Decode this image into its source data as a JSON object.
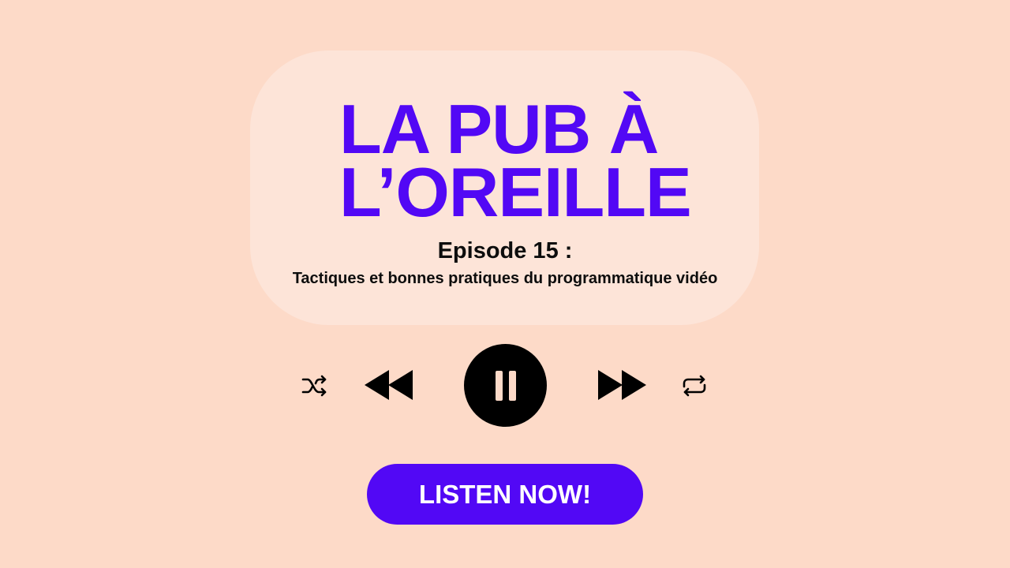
{
  "title": {
    "line1": "LA PUB À",
    "line2": "L’OREILLE"
  },
  "episode": {
    "label": "Episode 15 :",
    "subtitle": "Tactiques et bonnes pratiques du programmatique vidéo"
  },
  "controls": {
    "shuffle_icon": "shuffle-icon",
    "rewind_icon": "rewind-icon",
    "pause_icon": "pause-icon",
    "fast_forward_icon": "fast-forward-icon",
    "repeat_icon": "repeat-icon"
  },
  "cta": {
    "label": "LISTEN NOW!"
  },
  "colors": {
    "background": "#FDDAC8",
    "card": "#FDE4D8",
    "accent": "#5208F5",
    "text": "#0D0D0D"
  }
}
